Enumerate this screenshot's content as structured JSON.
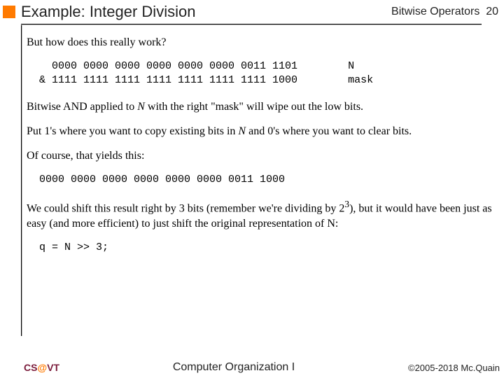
{
  "header": {
    "title": "Example: Integer Division",
    "chapter": "Bitwise Operators",
    "page": "20"
  },
  "content": {
    "intro": "But how does this really work?",
    "code1_line1": "  0000 0000 0000 0000 0000 0000 0011 1101        N",
    "code1_line2": "& 1111 1111 1111 1111 1111 1111 1111 1000        mask",
    "para1_a": "Bitwise AND applied to ",
    "para1_n": "N",
    "para1_b": " with the right \"mask\" will wipe out the low bits.",
    "para2_a": "Put 1's where you want to copy existing bits in ",
    "para2_n": "N",
    "para2_b": " and 0's where you want to clear bits.",
    "para3": "Of course, that yields this:",
    "code2": "0000 0000 0000 0000 0000 0000 0011 1000",
    "para4_a": "We could shift this result right by 3 bits (remember we're dividing by 2",
    "para4_sup": "3",
    "para4_b": "), but it would have been just as easy (and more efficient) to just shift the original representation of N:",
    "code3": "q = N >> 3;"
  },
  "footer": {
    "cs": "CS",
    "at": "@",
    "vt": "VT",
    "course": "Computer Organization I",
    "copyright": "©2005-2018 Mc.Quain"
  }
}
